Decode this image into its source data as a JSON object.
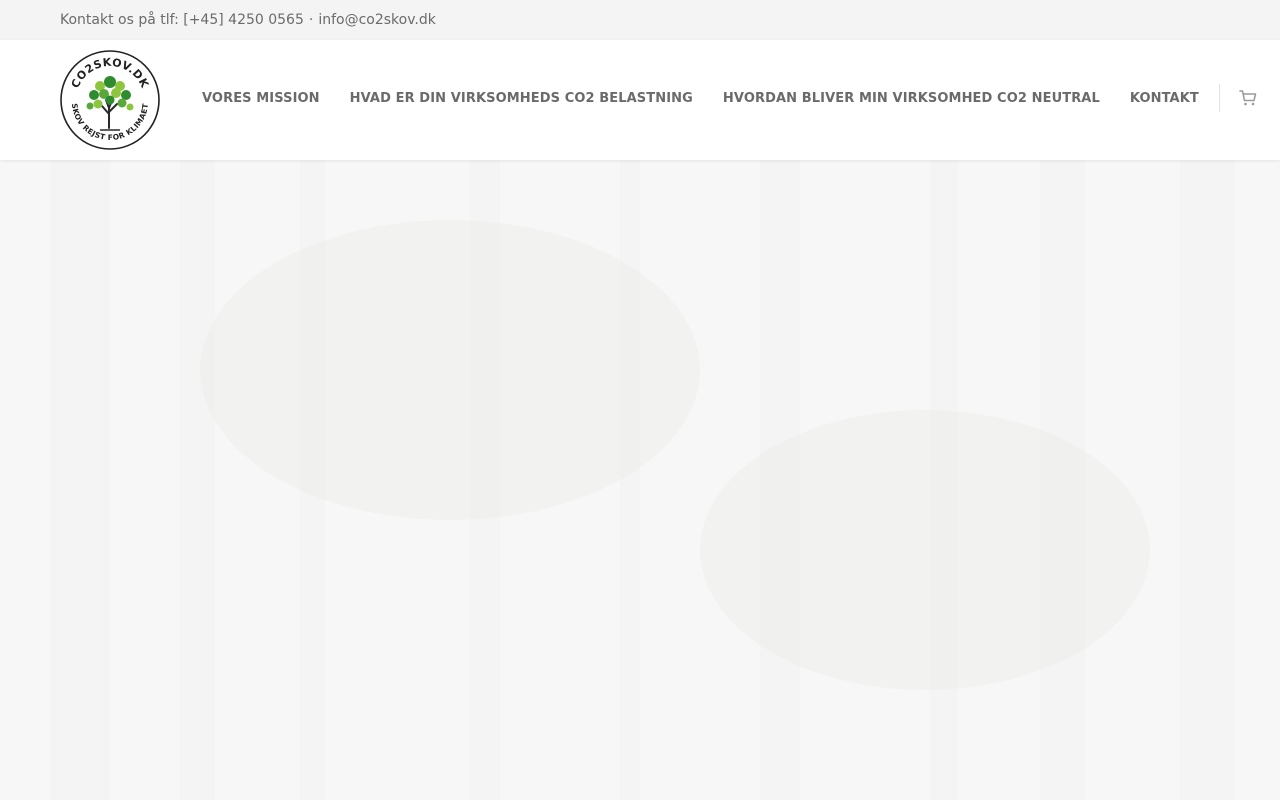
{
  "topbar": {
    "contact_text": "Kontakt os på tlf: [+45] 4250 0565",
    "separator": "·",
    "email": "info@co2skov.dk"
  },
  "logo": {
    "top_text": "CO2SKOV.DK",
    "bottom_text": "SKOV REJST FOR KLIMAET",
    "colors": {
      "ring": "#222222",
      "leaf_dark": "#2e8b2e",
      "leaf_light": "#8cc63f",
      "trunk": "#2a2a2a"
    }
  },
  "nav": {
    "items": [
      {
        "label": "VORES MISSION"
      },
      {
        "label": "HVAD ER DIN VIRKSOMHEDS CO2 BELASTNING"
      },
      {
        "label": "HVORDAN BLIVER MIN VIRKSOMHED CO2 NEUTRAL"
      },
      {
        "label": "KONTAKT"
      }
    ],
    "cart_icon": "shopping-cart-icon"
  },
  "colors": {
    "topbar_bg": "#f4f4f4",
    "header_bg": "#ffffff",
    "nav_text": "#6a6a6a",
    "hero_bg": "#f7f7f7"
  }
}
